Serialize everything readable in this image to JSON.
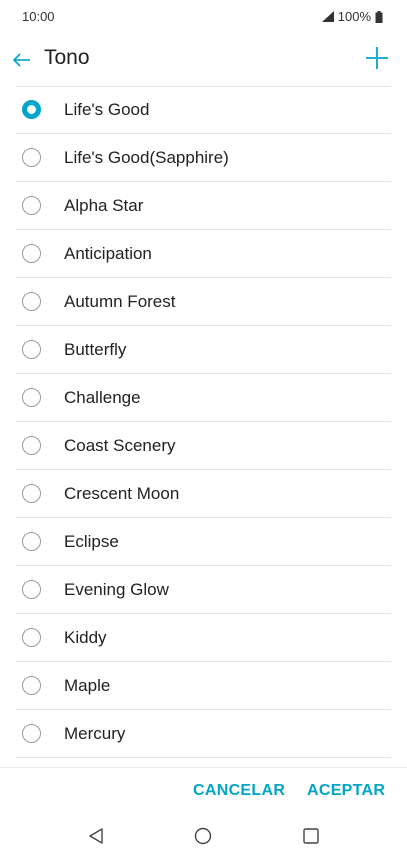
{
  "status_bar": {
    "time": "10:00",
    "battery": "100%",
    "signal_icon": "signal-icon",
    "battery_icon": "battery-icon"
  },
  "app_bar": {
    "title": "Tono",
    "back_icon": "arrow-left-icon",
    "add_icon": "plus-icon"
  },
  "colors": {
    "accent": "#00a5c8",
    "text": "#222222",
    "divider": "#e6e6e6"
  },
  "ringtones": [
    {
      "label": "Life's Good",
      "selected": true
    },
    {
      "label": "Life's Good(Sapphire)",
      "selected": false
    },
    {
      "label": "Alpha Star",
      "selected": false
    },
    {
      "label": "Anticipation",
      "selected": false
    },
    {
      "label": "Autumn Forest",
      "selected": false
    },
    {
      "label": "Butterfly",
      "selected": false
    },
    {
      "label": "Challenge",
      "selected": false
    },
    {
      "label": "Coast Scenery",
      "selected": false
    },
    {
      "label": "Crescent Moon",
      "selected": false
    },
    {
      "label": "Eclipse",
      "selected": false
    },
    {
      "label": "Evening Glow",
      "selected": false
    },
    {
      "label": "Kiddy",
      "selected": false
    },
    {
      "label": "Maple",
      "selected": false
    },
    {
      "label": "Mercury",
      "selected": false
    }
  ],
  "actions": {
    "cancel": "CANCELAR",
    "accept": "ACEPTAR"
  },
  "nav_bar": {
    "back_icon": "triangle-back-icon",
    "home_icon": "circle-home-icon",
    "recent_icon": "square-recents-icon"
  }
}
